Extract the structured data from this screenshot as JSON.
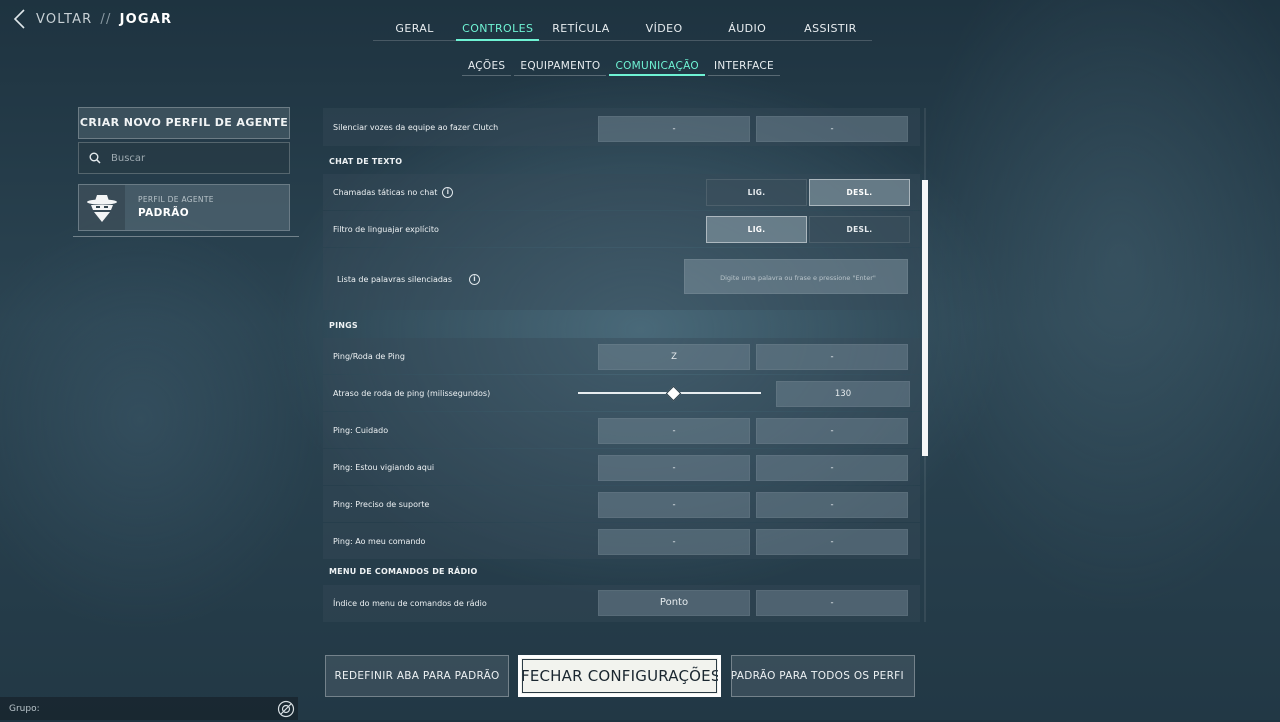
{
  "nav": {
    "back": "VOLTAR",
    "separator": "//",
    "current": "JOGAR"
  },
  "tabs": [
    {
      "label": "GERAL",
      "active": false
    },
    {
      "label": "CONTROLES",
      "active": true
    },
    {
      "label": "RETÍCULA",
      "active": false
    },
    {
      "label": "VÍDEO",
      "active": false
    },
    {
      "label": "ÁUDIO",
      "active": false
    },
    {
      "label": "ASSISTIR",
      "active": false
    }
  ],
  "subtabs": [
    {
      "label": "AÇÕES",
      "active": false
    },
    {
      "label": "EQUIPAMENTO",
      "active": false
    },
    {
      "label": "COMUNICAÇÃO",
      "active": true
    },
    {
      "label": "INTERFACE",
      "active": false
    }
  ],
  "sidebar": {
    "create_profile": "CRIAR NOVO PERFIL DE AGENTE",
    "search_placeholder": "Buscar",
    "profile_kind": "PERFIL DE AGENTE",
    "profile_name": "PADRÃO"
  },
  "settings": {
    "silence_clutch": {
      "label": "Silenciar vozes da equipe ao fazer Clutch",
      "primary": "-",
      "secondary": "-"
    },
    "text_chat_header": "CHAT DE TEXTO",
    "tactical_calls": {
      "label": "Chamadas táticas no chat",
      "on": "LIG.",
      "off": "DESL.",
      "selected": "off"
    },
    "explicit_filter": {
      "label": "Filtro de linguajar explícito",
      "on": "LIG.",
      "off": "DESL.",
      "selected": "on"
    },
    "muted_words": {
      "label": "Lista de palavras silenciadas",
      "placeholder": "Digite uma palavra ou frase e pressione \"Enter\""
    },
    "pings_header": "PINGS",
    "ping_wheel": {
      "label": "Ping/Roda de Ping",
      "primary": "Z",
      "secondary": "-"
    },
    "ping_delay": {
      "label": "Atraso de roda de ping (milissegundos)",
      "value": "130",
      "slider_fraction": 0.52
    },
    "ping_caution": {
      "label": "Ping: Cuidado",
      "primary": "-",
      "secondary": "-"
    },
    "ping_watching": {
      "label": "Ping: Estou vigiando aqui",
      "primary": "-",
      "secondary": "-"
    },
    "ping_support": {
      "label": "Ping: Preciso de suporte",
      "primary": "-",
      "secondary": "-"
    },
    "ping_command": {
      "label": "Ping: Ao meu comando",
      "primary": "-",
      "secondary": "-"
    },
    "radio_header": "MENU DE COMANDOS DE RÁDIO",
    "radio_index": {
      "label": "Índice do menu de comandos de rádio",
      "primary": "Ponto",
      "secondary": "-"
    }
  },
  "footer": {
    "reset_tab": "REDEFINIR ABA PARA PADRÃO",
    "close": "FECHAR CONFIGURAÇÕES",
    "reset_all": "AR PADRÃO PARA TODOS OS PERFI"
  },
  "group": {
    "label": "Grupo:"
  },
  "colors": {
    "accent": "#6ff3d4",
    "background": "#2b4452"
  },
  "icons": [
    "back-chevron-icon",
    "search-icon",
    "agent-profile-icon",
    "info-icon",
    "group-icon"
  ]
}
